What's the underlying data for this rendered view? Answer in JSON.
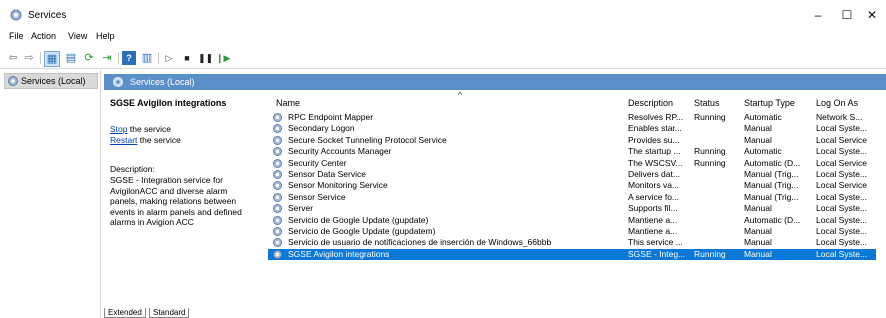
{
  "window": {
    "title": "Services"
  },
  "menu": [
    "File",
    "Action",
    "View",
    "Help"
  ],
  "tree": {
    "selected_label": "Services (Local)"
  },
  "header_band": {
    "label": "Services (Local)"
  },
  "description_pane": {
    "service_name": "SGSE Avigilon integrations",
    "stop_link": "Stop",
    "stop_rest": " the service",
    "restart_link": "Restart",
    "restart_rest": " the service",
    "description_label": "Description:",
    "description_text": "SGSE - Integration service for\nAvigilonACC and diverse alarm\npanels,  making relations between\nevents in alarm panels and defined\nalarms in Avigion ACC"
  },
  "table": {
    "columns": [
      "Name",
      "Description",
      "Status",
      "Startup Type",
      "Log On As"
    ],
    "rows": [
      [
        "RPC Endpoint Mapper",
        "Resolves RP...",
        "Running",
        "Automatic",
        "Network S..."
      ],
      [
        "Secondary Logon",
        "Enables star...",
        "",
        "Manual",
        "Local Syste..."
      ],
      [
        "Secure Socket Tunneling Protocol Service",
        "Provides su...",
        "",
        "Manual",
        "Local Service"
      ],
      [
        "Security Accounts Manager",
        "The startup ...",
        "Running",
        "Automatic",
        "Local Syste..."
      ],
      [
        "Security Center",
        "The WSCSV...",
        "Running",
        "Automatic (D...",
        "Local Service"
      ],
      [
        "Sensor Data Service",
        "Delivers dat...",
        "",
        "Manual (Trig...",
        "Local Syste..."
      ],
      [
        "Sensor Monitoring Service",
        "Monitors va...",
        "",
        "Manual (Trig...",
        "Local Service"
      ],
      [
        "Sensor Service",
        "A service fo...",
        "",
        "Manual (Trig...",
        "Local Syste..."
      ],
      [
        "Server",
        "Supports fil...",
        "",
        "Manual",
        "Local Syste..."
      ],
      [
        "Servicio de Google Update (gupdate)",
        "Mantiene a...",
        "",
        "Automatic (D...",
        "Local Syste..."
      ],
      [
        "Servicio de Google Update (gupdatem)",
        "Mantiene a...",
        "",
        "Manual",
        "Local Syste..."
      ],
      [
        "Servicio de usuario de notificaciones de inserción de Windows_66bbb",
        "This service ...",
        "",
        "Manual",
        "Local Syste..."
      ],
      [
        "SGSE Avigilon integrations",
        "SGSE - Integ...",
        "Running",
        "Manual",
        "Local Syste..."
      ]
    ],
    "selected_index": 12
  },
  "tabs": [
    "Extended",
    "Standard"
  ],
  "colors": {
    "selection": "#0a78d4",
    "header_band": "#5b8fc9"
  }
}
